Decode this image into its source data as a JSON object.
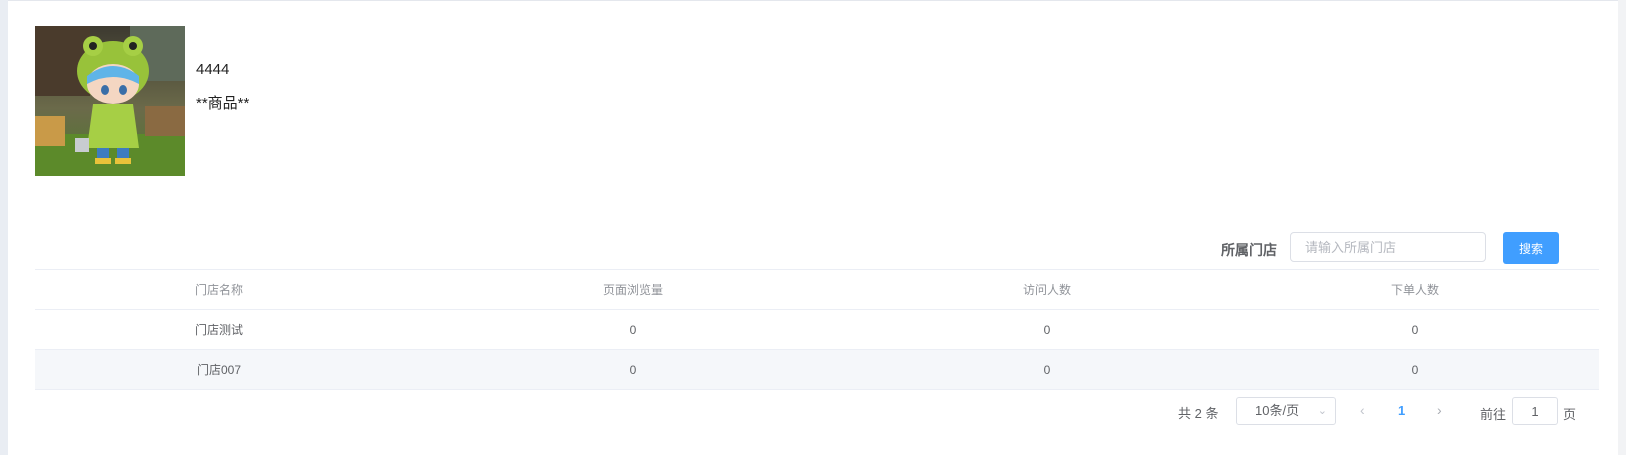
{
  "product": {
    "id": "4444",
    "name": "**商品**",
    "image_icon": "product-thumbnail-frog-figure"
  },
  "filter": {
    "label": "所属门店",
    "placeholder": "请输入所属门店",
    "value": "",
    "search_label": "搜索"
  },
  "table": {
    "columns": [
      "门店名称",
      "页面浏览量",
      "访问人数",
      "下单人数"
    ],
    "rows": [
      [
        "门店测试",
        "0",
        "0",
        "0"
      ],
      [
        "门店007",
        "0",
        "0",
        "0"
      ]
    ]
  },
  "pagination": {
    "total_text": "共 2 条",
    "page_size": "10条/页",
    "current_page": "1",
    "goto_label": "前往",
    "goto_value": "1",
    "goto_suffix": "页",
    "prev_icon": "chevron-left-icon",
    "next_icon": "chevron-right-icon"
  },
  "colors": {
    "primary": "#409eff",
    "border": "#dcdfe6",
    "stripe": "#f5f7fa"
  }
}
